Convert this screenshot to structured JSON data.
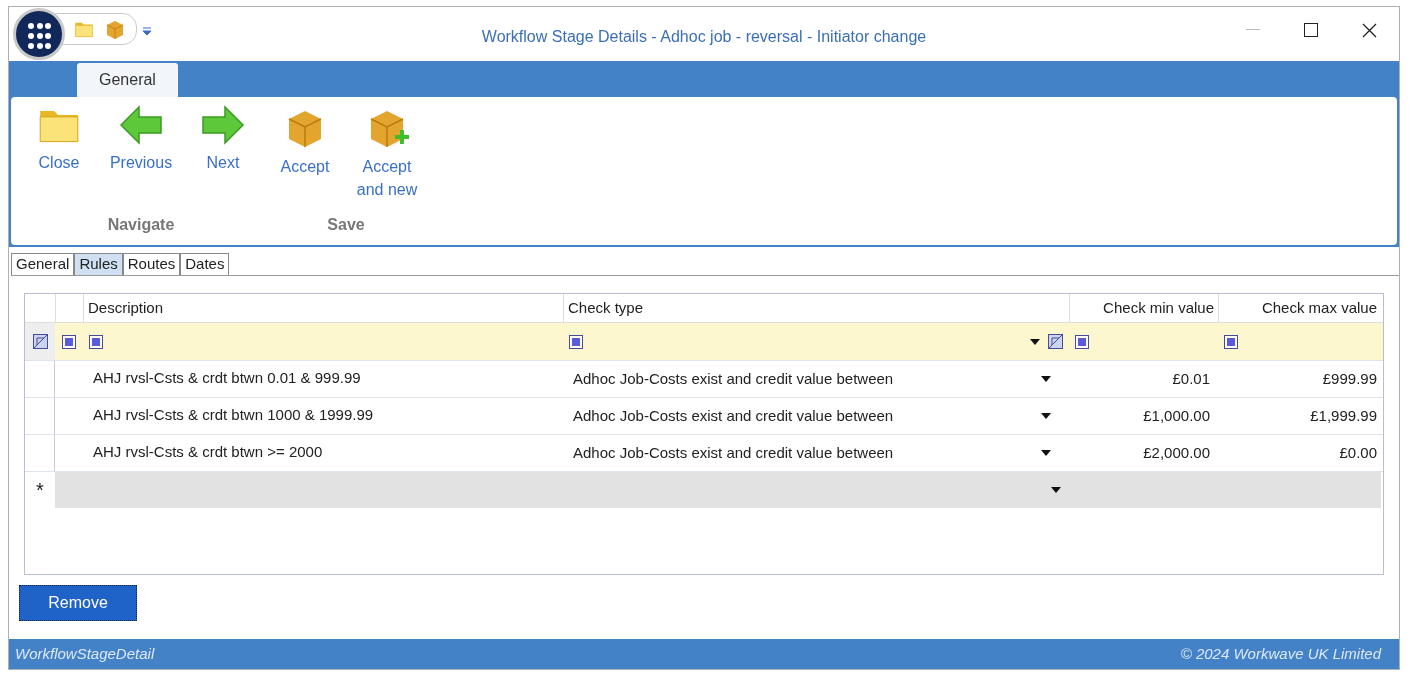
{
  "window": {
    "title": "Workflow Stage Details - Adhoc job - reversal - Initiator change"
  },
  "ribbon": {
    "tabs": [
      {
        "label": "General",
        "selected": true
      }
    ],
    "groups": [
      {
        "label": "Navigate",
        "buttons": [
          {
            "label": "Close",
            "kind": "folder"
          },
          {
            "label": "Previous",
            "kind": "back"
          },
          {
            "label": "Next",
            "kind": "forward"
          }
        ]
      },
      {
        "label": "Save",
        "buttons": [
          {
            "label": "Accept",
            "kind": "box"
          },
          {
            "label": "Accept and new",
            "kind": "box-add"
          }
        ]
      }
    ]
  },
  "tabs": [
    {
      "label": "General",
      "selected": false
    },
    {
      "label": "Rules",
      "selected": true
    },
    {
      "label": "Routes",
      "selected": false
    },
    {
      "label": "Dates",
      "selected": false
    }
  ],
  "grid": {
    "columns": [
      "Description",
      "Check type",
      "Check min value",
      "Check max value"
    ],
    "rows": [
      {
        "description": "AHJ rvsl-Csts & crdt btwn 0.01 & 999.99",
        "check_type": "Adhoc Job-Costs exist and credit value between",
        "min": "£0.01",
        "max": "£999.99"
      },
      {
        "description": "AHJ rvsl-Csts & crdt btwn 1000 & 1999.99",
        "check_type": "Adhoc Job-Costs exist and credit value between",
        "min": "£1,000.00",
        "max": "£1,999.99"
      },
      {
        "description": "AHJ rvsl-Csts & crdt btwn >= 2000",
        "check_type": "Adhoc Job-Costs exist and credit value between",
        "min": "£2,000.00",
        "max": "£0.00"
      }
    ],
    "new_row_marker": "*"
  },
  "remove_button": "Remove",
  "status_bar": {
    "left": "WorkflowStageDetail",
    "right": "© 2024 Workwave UK Limited"
  }
}
